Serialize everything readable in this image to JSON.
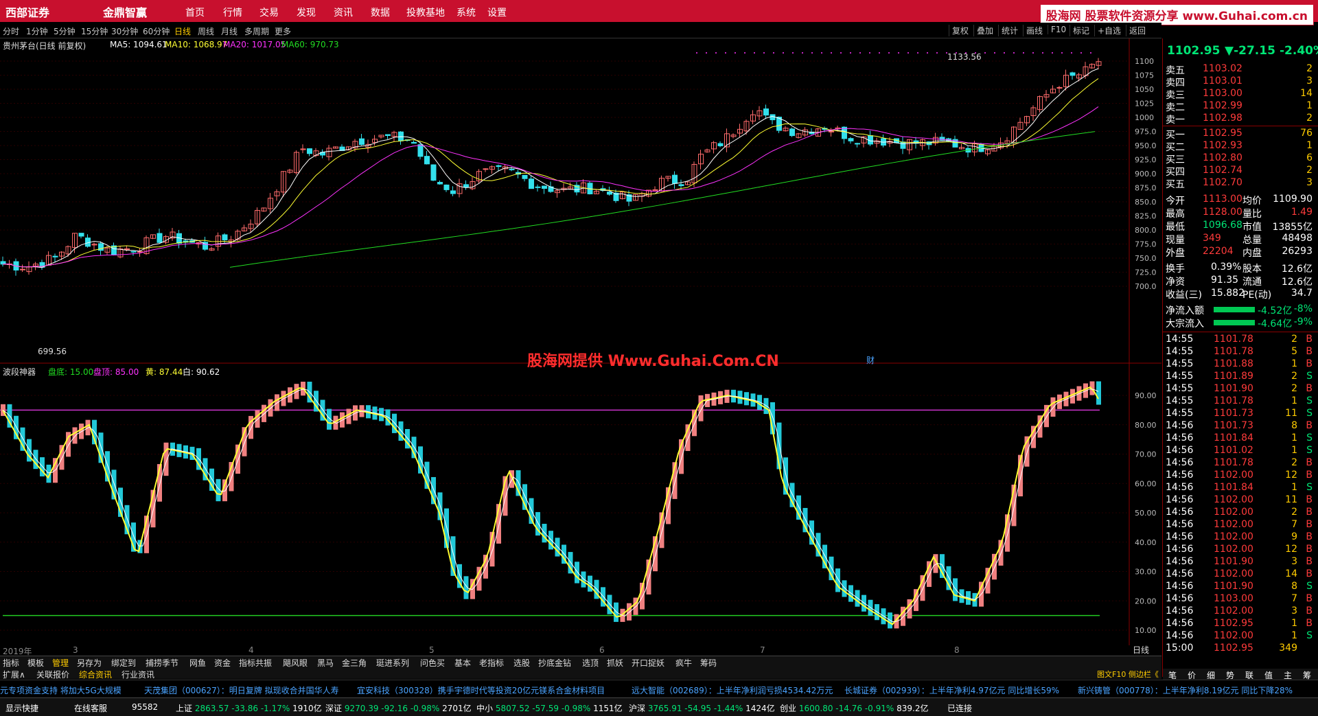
{
  "topbar": {
    "brand1": "西部证券",
    "brand2": "金鼎智赢",
    "menu": [
      "首页",
      "行情",
      "交易",
      "发现",
      "资讯",
      "数据",
      "投教基地",
      "系统",
      "设置"
    ],
    "watermark": "股海网 股票软件资源分享 www.Guhai.com.cn"
  },
  "periods": [
    "分时",
    "1分钟",
    "5分钟",
    "15分钟",
    "30分钟",
    "60分钟",
    "日线",
    "周线",
    "月线",
    "多周期",
    "更多"
  ],
  "active_period": "日线",
  "right_tools": [
    "复权",
    "叠加",
    "统计",
    "画线",
    "F10",
    "标记",
    "+自选",
    "返回"
  ],
  "main": {
    "stock_title": "贵州茅台(日线 前复权)",
    "ma5": "MA5: 1094.61",
    "ma10": "MA10: 1068.97",
    "ma20": "MA20: 1017.05",
    "ma60": "MA60: 970.73",
    "high_mark": "1133.56",
    "low_mark": "699.56",
    "cai_mark": "财",
    "y_axis": [
      "1100",
      "1075",
      "1050",
      "1025",
      "1000",
      "975.0",
      "950.0",
      "925.0",
      "900.0",
      "875.0",
      "850.0",
      "825.0",
      "800.0",
      "775.0",
      "750.0",
      "725.0",
      "700.0"
    ],
    "colors": {
      "up": "#ff6b6b",
      "down": "#33e0ec",
      "ma5": "#ffffff",
      "ma10": "#ffff33",
      "ma20": "#ff33ff",
      "ma60": "#22dd22"
    }
  },
  "indicator": {
    "name": "波段神器",
    "pandi": "盘底: 15.00",
    "panding": "盘顶: 85.00",
    "huang": "黄: 87.44",
    "bai": "白: 90.62",
    "y_axis": [
      "90.00",
      "80.00",
      "70.00",
      "60.00",
      "50.00",
      "40.00",
      "30.00",
      "20.00",
      "10.00"
    ],
    "top_line": 85,
    "bottom_line": 15
  },
  "x_axis": [
    "2019年",
    "3",
    "4",
    "5",
    "6",
    "7",
    "8"
  ],
  "watermark_center": "股海网提供 Www.Guhai.Com.CN",
  "quote": {
    "price": "1102.95",
    "change": "▼-27.15",
    "pct": "-2.40%",
    "asks": [
      {
        "label": "卖五",
        "price": "1103.02",
        "vol": "2"
      },
      {
        "label": "卖四",
        "price": "1103.01",
        "vol": "3"
      },
      {
        "label": "卖三",
        "price": "1103.00",
        "vol": "14"
      },
      {
        "label": "卖二",
        "price": "1102.99",
        "vol": "1"
      },
      {
        "label": "卖一",
        "price": "1102.98",
        "vol": "2"
      }
    ],
    "bids": [
      {
        "label": "买一",
        "price": "1102.95",
        "vol": "76"
      },
      {
        "label": "买二",
        "price": "1102.93",
        "vol": "1"
      },
      {
        "label": "买三",
        "price": "1102.80",
        "vol": "6"
      },
      {
        "label": "买四",
        "price": "1102.74",
        "vol": "2"
      },
      {
        "label": "买五",
        "price": "1102.70",
        "vol": "3"
      }
    ],
    "stats": [
      {
        "l1": "今开",
        "v1": "1113.00",
        "l2": "均价",
        "v2": "1109.90"
      },
      {
        "l1": "最高",
        "v1": "1128.00",
        "l2": "量比",
        "v2": "1.49"
      },
      {
        "l1": "最低",
        "v1": "1096.68",
        "l2": "市值",
        "v2": "13855亿"
      },
      {
        "l1": "现量",
        "v1": "349",
        "l2": "总量",
        "v2": "48498"
      },
      {
        "l1": "外盘",
        "v1": "22204",
        "l2": "内盘",
        "v2": "26293"
      }
    ],
    "stats2": [
      {
        "l1": "换手",
        "v1": "0.39%",
        "l2": "股本",
        "v2": "12.6亿"
      },
      {
        "l1": "净资",
        "v1": "91.35",
        "l2": "流通",
        "v2": "12.6亿"
      },
      {
        "l1": "收益(三)",
        "v1": "15.882",
        "l2": "PE(动)",
        "v2": "34.7"
      }
    ],
    "flows": [
      {
        "l": "净流入额",
        "v": "-4.52亿",
        "p": "-8%"
      },
      {
        "l": "大宗流入",
        "v": "-4.64亿",
        "p": "-9%"
      }
    ],
    "ticks": [
      [
        "14:55",
        "1101.78",
        "2",
        "B"
      ],
      [
        "14:55",
        "1101.78",
        "5",
        "B"
      ],
      [
        "14:55",
        "1101.88",
        "1",
        "B"
      ],
      [
        "14:55",
        "1101.89",
        "2",
        "S"
      ],
      [
        "14:55",
        "1101.90",
        "2",
        "B"
      ],
      [
        "14:55",
        "1101.78",
        "1",
        "S"
      ],
      [
        "14:55",
        "1101.73",
        "11",
        "S"
      ],
      [
        "14:56",
        "1101.73",
        "8",
        "B"
      ],
      [
        "14:56",
        "1101.84",
        "1",
        "S"
      ],
      [
        "14:56",
        "1101.02",
        "1",
        "S"
      ],
      [
        "14:56",
        "1101.78",
        "2",
        "B"
      ],
      [
        "14:56",
        "1102.00",
        "12",
        "B"
      ],
      [
        "14:56",
        "1101.84",
        "1",
        "S"
      ],
      [
        "14:56",
        "1102.00",
        "11",
        "B"
      ],
      [
        "14:56",
        "1102.00",
        "2",
        "B"
      ],
      [
        "14:56",
        "1102.00",
        "7",
        "B"
      ],
      [
        "14:56",
        "1102.00",
        "9",
        "B"
      ],
      [
        "14:56",
        "1102.00",
        "12",
        "B"
      ],
      [
        "14:56",
        "1101.90",
        "3",
        "B"
      ],
      [
        "14:56",
        "1102.00",
        "14",
        "B"
      ],
      [
        "14:56",
        "1101.90",
        "8",
        "S"
      ],
      [
        "14:56",
        "1103.00",
        "7",
        "B"
      ],
      [
        "14:56",
        "1102.00",
        "3",
        "B"
      ],
      [
        "14:56",
        "1102.95",
        "1",
        "B"
      ],
      [
        "14:56",
        "1102.00",
        "1",
        "S"
      ],
      [
        "15:00",
        "1102.95",
        "349",
        ""
      ]
    ],
    "bottom_tabs": [
      "笔",
      "价",
      "细",
      "势",
      "联",
      "值",
      "主",
      "筹"
    ]
  },
  "tabs_row1": [
    "指标",
    "模板",
    "管理",
    "另存为",
    "绑定到",
    "捕捞季节",
    "网鱼",
    "资金",
    "指标共振",
    "飓风眼",
    "黑马",
    "金三角",
    "珽进系列",
    "问色买",
    "基本",
    "老指标",
    "选股",
    "抄底金钻",
    "选顶",
    "抓妖",
    "开口捉妖",
    "疯牛",
    "筹码"
  ],
  "tabs_row2": [
    "扩展∧",
    "关联报价",
    "综合资讯",
    "行业资讯"
  ],
  "tab_right": "日线",
  "tab_right2": "图文F10 侧边栏《",
  "ticker": [
    "元专项资金支持  将加大5G大规模",
    "天茂集团（000627）：明日复牌 拟现收合并国华人寿",
    "宜安科技（300328）携手宇德时代等投资20亿元镁系合金材料项目",
    "远大智能（002689）：上半年净利润亏损4534.42万元",
    "长城证券（002939）：上半年净利4.97亿元 同比增长59%",
    "新兴铸管（000778）：上半年净利8.19亿元 同比下降28%"
  ],
  "status": {
    "quick": "显示快捷",
    "service": "在线客服",
    "phone": "95582",
    "sh": {
      "name": "上证",
      "val": "2863.57",
      "chg": "-33.86",
      "pct": "-1.17%",
      "amt": "1910亿"
    },
    "sz": {
      "name": "深证",
      "val": "9270.39",
      "chg": "-92.16",
      "pct": "-0.98%",
      "amt": "2701亿"
    },
    "zx": {
      "name": "中小",
      "val": "5807.52",
      "chg": "-57.59",
      "pct": "-0.98%",
      "amt": "1151亿"
    },
    "hs": {
      "name": "沪深",
      "val": "3765.91",
      "chg": "-54.95",
      "pct": "-1.44%",
      "amt": "1424亿"
    },
    "cy": {
      "name": "创业",
      "val": "1600.80",
      "chg": "-14.76",
      "pct": "-0.91%",
      "amt": "839.2亿"
    },
    "conn": "已连接"
  }
}
